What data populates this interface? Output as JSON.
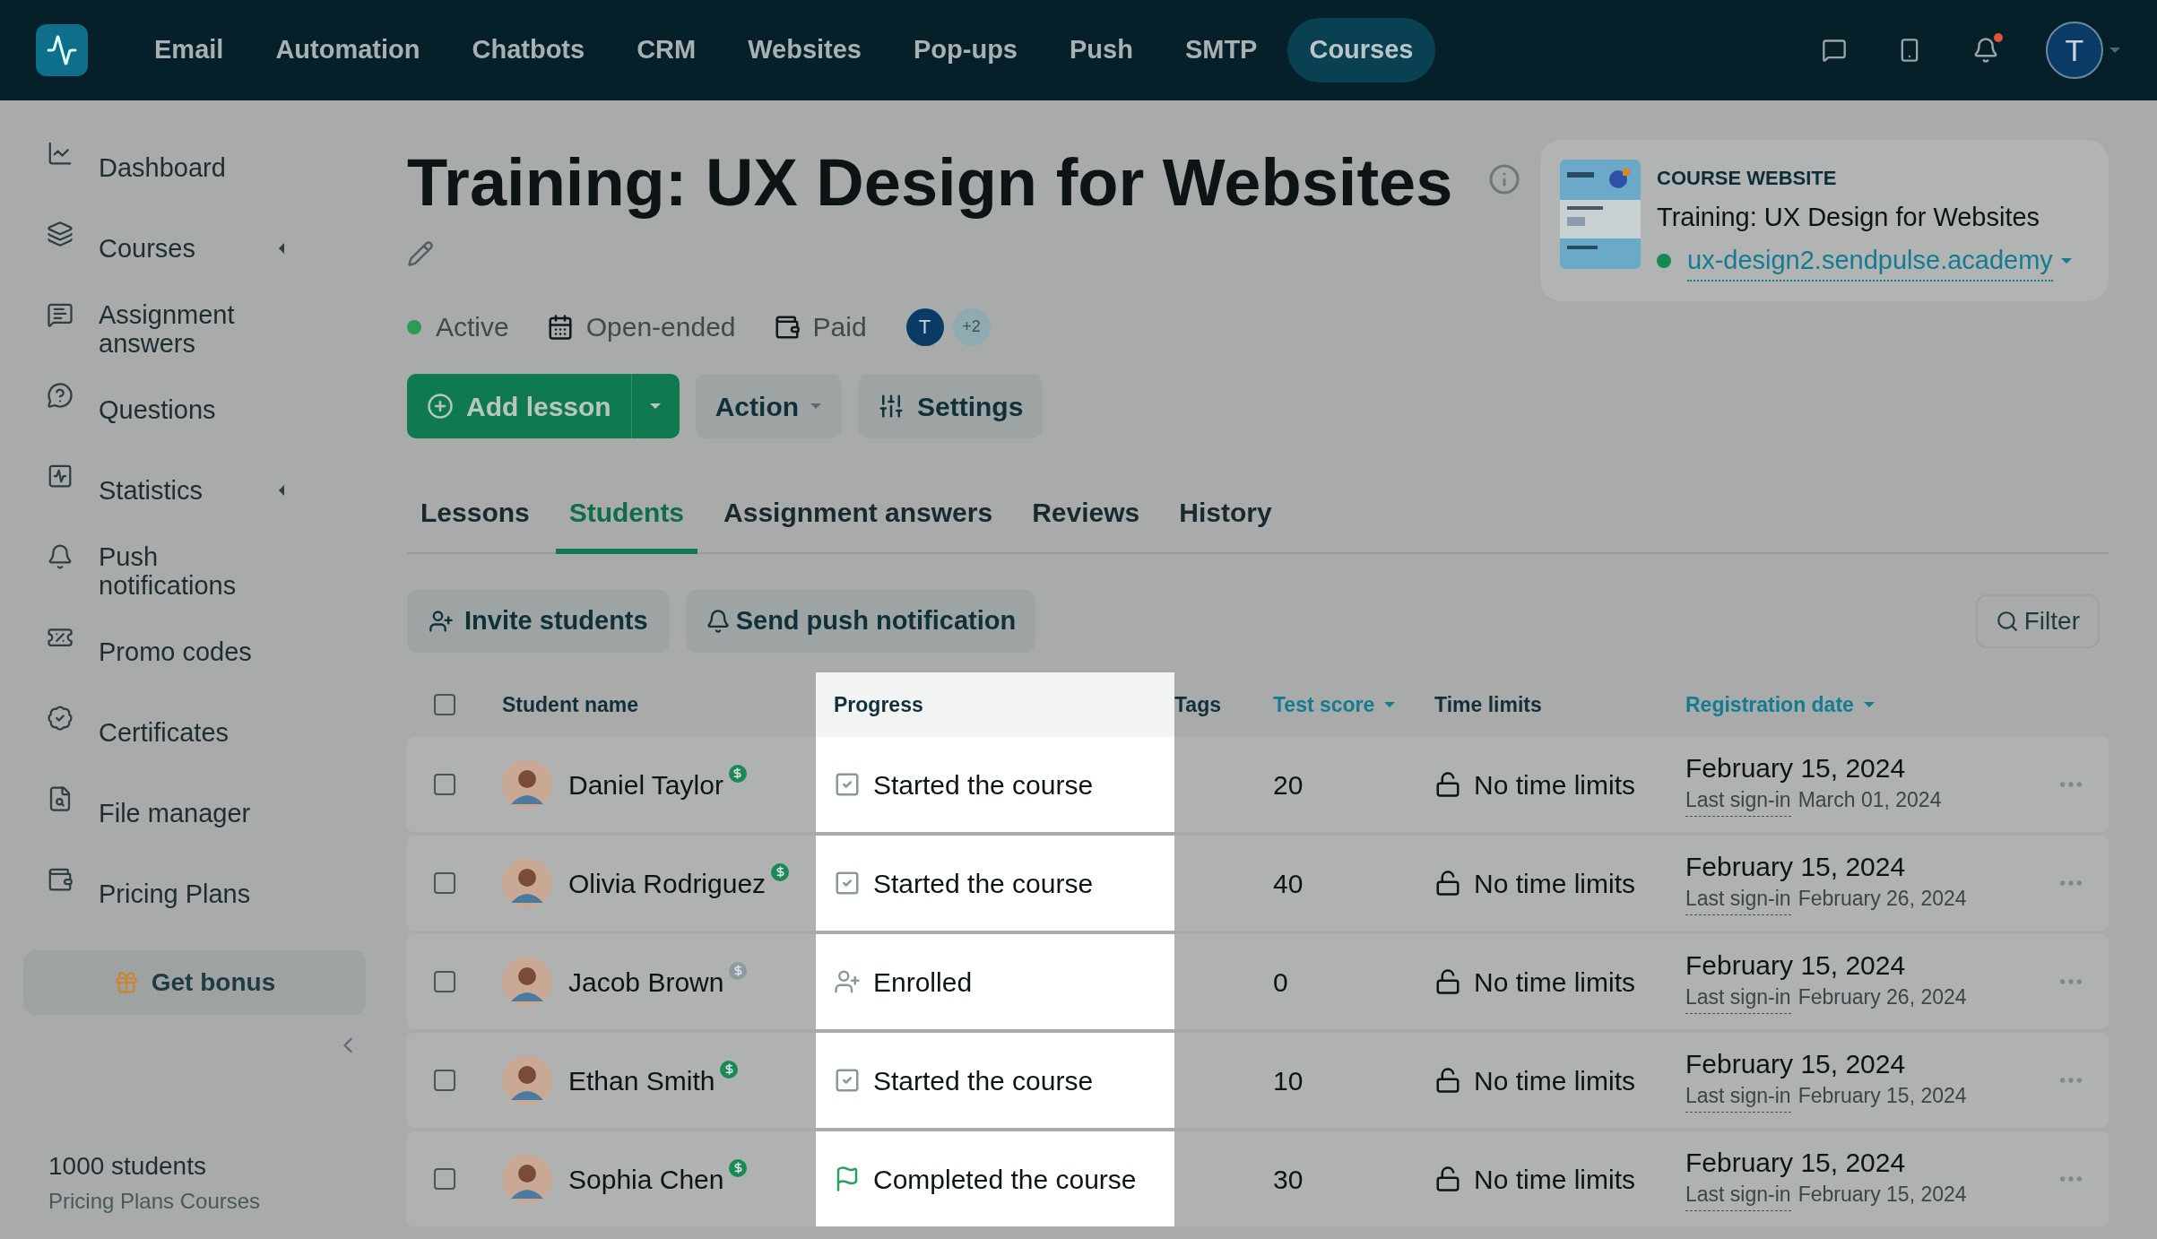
{
  "top_nav": {
    "items": [
      {
        "label": "Email",
        "selected": false
      },
      {
        "label": "Automation",
        "selected": false
      },
      {
        "label": "Chatbots",
        "selected": false
      },
      {
        "label": "CRM",
        "selected": false
      },
      {
        "label": "Websites",
        "selected": false
      },
      {
        "label": "Pop-ups",
        "selected": false
      },
      {
        "label": "Push",
        "selected": false
      },
      {
        "label": "SMTP",
        "selected": false
      },
      {
        "label": "Courses",
        "selected": true
      }
    ],
    "notifications_unread": true,
    "avatar": "T"
  },
  "sidebar": {
    "items": [
      {
        "label": "Dashboard",
        "expandable": false
      },
      {
        "label": "Courses",
        "expandable": true
      },
      {
        "label": "Assignment answers",
        "expandable": false
      },
      {
        "label": "Questions",
        "expandable": false
      },
      {
        "label": "Statistics",
        "expandable": true
      },
      {
        "label": "Push notifications",
        "expandable": false
      },
      {
        "label": "Promo codes",
        "expandable": false
      },
      {
        "label": "Certificates",
        "expandable": false
      },
      {
        "label": "File manager",
        "expandable": false
      },
      {
        "label": "Pricing Plans",
        "expandable": false
      }
    ],
    "bonus_button": "Get bonus",
    "plan": {
      "students": "1000 students",
      "name": "Pricing Plans Courses"
    }
  },
  "course": {
    "title": "Training: UX Design for Websites",
    "status": "Active",
    "duration": "Open-ended",
    "pricing": "Paid",
    "authors": [
      "T"
    ],
    "more_authors": "+2",
    "buttons": {
      "add": "Add lesson",
      "action": "Action",
      "settings": "Settings"
    },
    "website": {
      "heading": "COURSE WEBSITE",
      "title": "Training: UX Design for Websites",
      "url": "ux-design2.sendpulse.academy",
      "published": true
    }
  },
  "tabs": [
    {
      "label": "Lessons",
      "selected": false
    },
    {
      "label": "Students",
      "selected": true
    },
    {
      "label": "Assignment answers",
      "selected": false
    },
    {
      "label": "Reviews",
      "selected": false
    },
    {
      "label": "History",
      "selected": false
    }
  ],
  "toolbar": {
    "invite": "Invite students",
    "push": "Send push notification",
    "filter": "Filter"
  },
  "table": {
    "select_all_checked": false,
    "columns": [
      {
        "label": "Student name",
        "sortable": false
      },
      {
        "label": "Progress",
        "sortable": false
      },
      {
        "label": "Tags",
        "sortable": false
      },
      {
        "label": "Test score",
        "sortable": true
      },
      {
        "label": "Time limits",
        "sortable": false
      },
      {
        "label": "Registration date",
        "sortable": true
      }
    ],
    "rows": [
      {
        "checked": false,
        "name": "Daniel Taylor",
        "paid": true,
        "progress": {
          "kind": "started",
          "text": "Started the course"
        },
        "score": "20",
        "time_limit": "No time limits",
        "registered": "February 15, 2024",
        "last_signin_label": "Last sign-in",
        "last_signin": "March 01, 2024"
      },
      {
        "checked": false,
        "name": "Olivia Rodriguez",
        "paid": true,
        "progress": {
          "kind": "started",
          "text": "Started the course"
        },
        "score": "40",
        "time_limit": "No time limits",
        "registered": "February 15, 2024",
        "last_signin_label": "Last sign-in",
        "last_signin": "February 26, 2024"
      },
      {
        "checked": false,
        "name": "Jacob Brown",
        "paid": false,
        "progress": {
          "kind": "enrolled",
          "text": "Enrolled"
        },
        "score": "0",
        "time_limit": "No time limits",
        "registered": "February 15, 2024",
        "last_signin_label": "Last sign-in",
        "last_signin": "February 26, 2024"
      },
      {
        "checked": false,
        "name": "Ethan Smith",
        "paid": true,
        "progress": {
          "kind": "started",
          "text": "Started the course"
        },
        "score": "10",
        "time_limit": "No time limits",
        "registered": "February 15, 2024",
        "last_signin_label": "Last sign-in",
        "last_signin": "February 15, 2024"
      },
      {
        "checked": false,
        "name": "Sophia Chen",
        "paid": true,
        "progress": {
          "kind": "completed",
          "text": "Completed the course"
        },
        "score": "30",
        "time_limit": "No time limits",
        "registered": "February 15, 2024",
        "last_signin_label": "Last sign-in",
        "last_signin": "February 15, 2024"
      }
    ]
  }
}
